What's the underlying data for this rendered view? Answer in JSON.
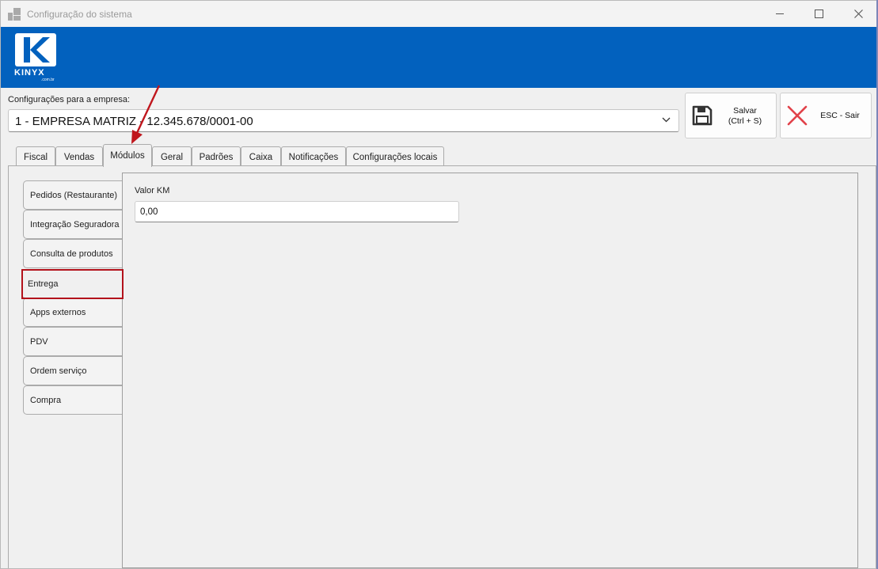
{
  "window": {
    "title": "Configuração do sistema",
    "controls": [
      "minimize-icon",
      "maximize-icon",
      "close-icon"
    ]
  },
  "banner": {
    "brand": "KINYX",
    "brand_sub": ".com.br",
    "color": "#0261be"
  },
  "company": {
    "label": "Configurações para a empresa:",
    "selected": "1 - EMPRESA MATRIZ - 12.345.678/0001-00"
  },
  "toolbar": {
    "save_label": "Salvar",
    "save_shortcut": "(Ctrl + S)",
    "exit_label": "ESC - Sair"
  },
  "tabs": [
    {
      "label": "Fiscal"
    },
    {
      "label": "Vendas"
    },
    {
      "label": "Módulos",
      "active": true
    },
    {
      "label": "Geral"
    },
    {
      "label": "Padrões"
    },
    {
      "label": "Caixa"
    },
    {
      "label": "Notificações"
    },
    {
      "label": "Configurações locais"
    }
  ],
  "modules": [
    {
      "label": "Pedidos (Restaurante)"
    },
    {
      "label": "Integração Seguradora"
    },
    {
      "label": "Consulta de produtos"
    },
    {
      "label": "Entrega",
      "active": true,
      "highlighted": true
    },
    {
      "label": "Apps externos"
    },
    {
      "label": "PDV"
    },
    {
      "label": "Ordem serviço"
    },
    {
      "label": "Compra"
    }
  ],
  "panel": {
    "field_label": "Valor KM",
    "field_value": "0,00"
  },
  "annotation": {
    "highlight_color": "#b3121b",
    "arrow_color": "#c0161d"
  }
}
